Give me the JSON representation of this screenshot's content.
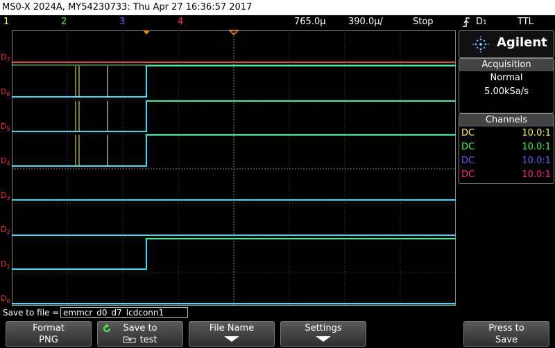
{
  "title": "MS0-X 2024A, MY54230733: Thu Apr 27 16:36:57 2017",
  "status": {
    "channels": [
      "1",
      "2",
      "3",
      "4"
    ],
    "channel_colors": [
      "#ffff40",
      "#40ff40",
      "#6060ff",
      "#ff2080"
    ],
    "time_per_div": "765.0µ",
    "delay": "390.0µ/",
    "run_state": "Stop",
    "trigger_source": "D",
    "trigger_source_sub": "1",
    "trigger_level": "TTL"
  },
  "digital_labels": [
    {
      "name": "D",
      "sub": "7"
    },
    {
      "name": "D",
      "sub": "6"
    },
    {
      "name": "D",
      "sub": "5"
    },
    {
      "name": "D",
      "sub": "4"
    },
    {
      "name": "D",
      "sub": "3"
    },
    {
      "name": "D",
      "sub": "2"
    },
    {
      "name": "D",
      "sub": "1"
    },
    {
      "name": "D",
      "sub": "0"
    }
  ],
  "brand": "Agilent",
  "acquisition": {
    "header": "Acquisition",
    "mode": "Normal",
    "rate": "5.00kSa/s"
  },
  "channels_panel": {
    "header": "Channels",
    "rows": [
      {
        "coupling": "DC",
        "ratio": "10.0:1",
        "color": "#ffff40"
      },
      {
        "coupling": "DC",
        "ratio": "10.0:1",
        "color": "#40ff40"
      },
      {
        "coupling": "DC",
        "ratio": "10.0:1",
        "color": "#6060ff"
      },
      {
        "coupling": "DC",
        "ratio": "10.0:1",
        "color": "#ff2080"
      }
    ]
  },
  "save": {
    "label": "Save to file =",
    "filename": "emmcr_d0_d7_lcdconn1"
  },
  "softkeys": [
    {
      "line1": "Format",
      "line2": "PNG"
    },
    {
      "line1": "Save to",
      "line2": "test"
    },
    {
      "line1": "File Name",
      "line2": ""
    },
    {
      "line1": "Settings",
      "line2": ""
    },
    {
      "line1": "Press to",
      "line2": "Save"
    }
  ]
}
